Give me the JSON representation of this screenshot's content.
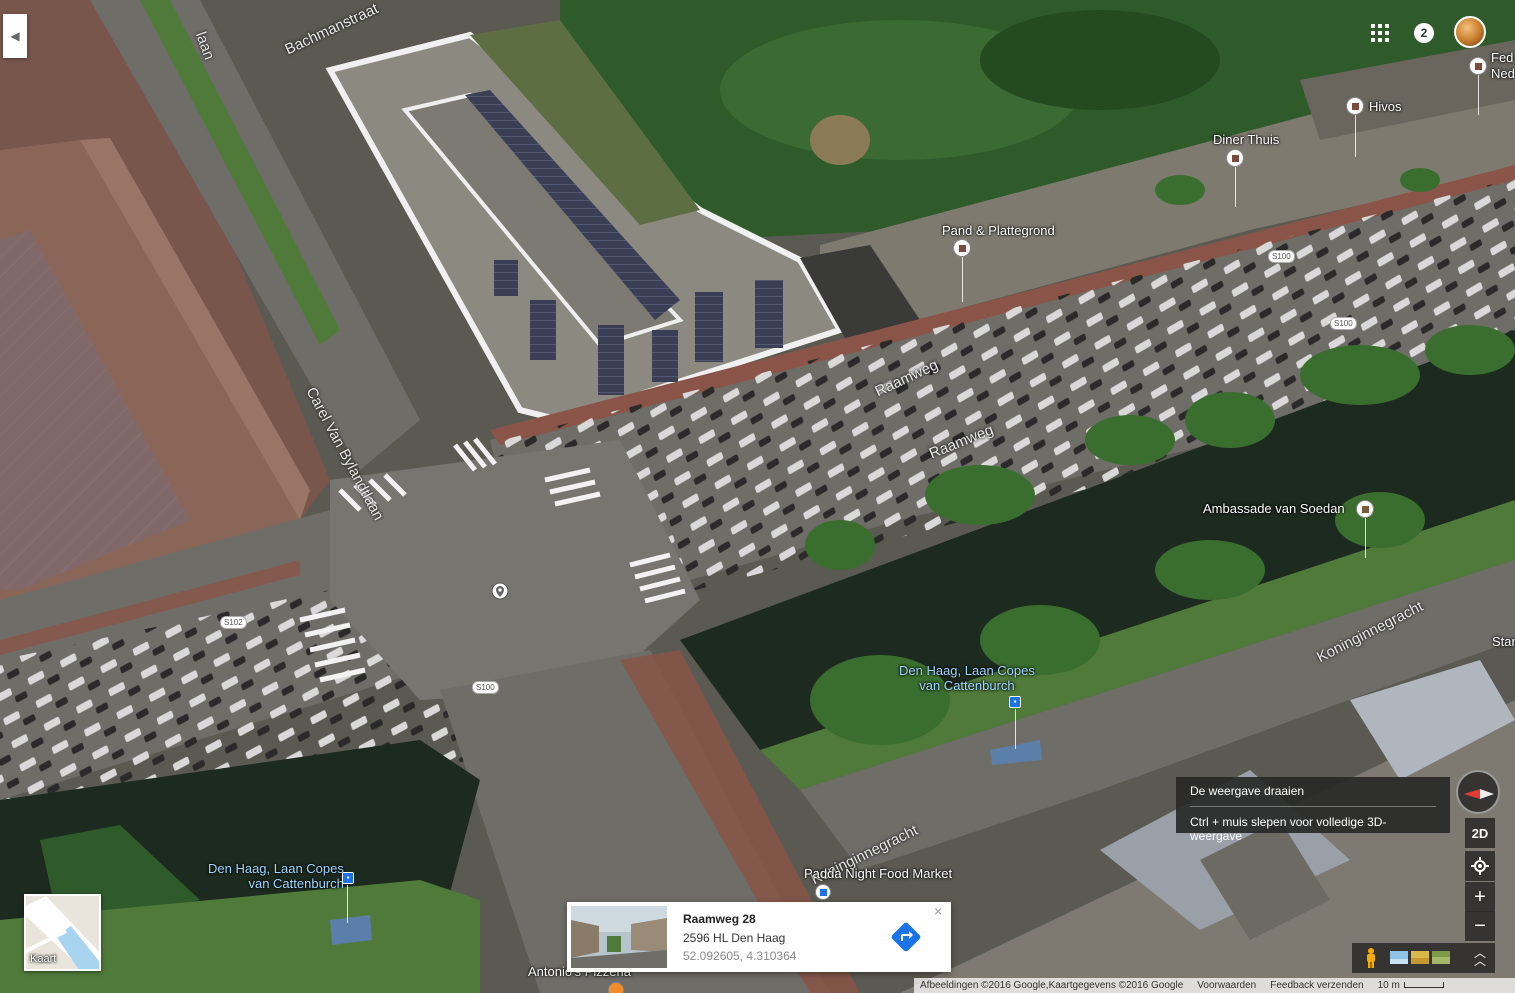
{
  "streets": {
    "bachmanstraat": "Bachmanstraat",
    "laan_top": "laan",
    "carel_van_bylandtlaan": "Carel Van Bylandtlaan",
    "raamweg_1": "Raamweg",
    "raamweg_2": "Raamweg",
    "koninginnegracht": "Koninginnegracht",
    "koninginnegracht_bottom": "Koninginnegracht"
  },
  "road_shields": {
    "s100_a": "S100",
    "s100_b": "S100",
    "s100_c": "S100",
    "s102": "S102"
  },
  "pois": {
    "pand_plattegrond": "Pand & Plattegrond",
    "diner_thuis": "Diner Thuis",
    "hivos": "Hivos",
    "fed_line1": "Fed",
    "fed_line2": "Ned",
    "ambassade_van_soedan": "Ambassade van Soedan",
    "den_haag_stop_1_line1": "Den Haag, Laan Copes",
    "den_haag_stop_1_line2": "van Cattenburch",
    "den_haag_stop_2_line1": "Den Haag, Laan Copes",
    "den_haag_stop_2_line2": "van Cattenburch",
    "padda_night_food_market": "Padda Night Food Market",
    "antonios_pizzeria": "Antonio's Pizzeria",
    "star_partial": "Star"
  },
  "header": {
    "notification_count": "2"
  },
  "tooltip": {
    "line1": "De weergave draaien",
    "line2": "Ctrl + muis slepen voor volledige 3D-weergave"
  },
  "controls": {
    "toggle_2d": "2D",
    "zoom_in": "+",
    "zoom_out": "−"
  },
  "minimap": {
    "label": "Kaart"
  },
  "place_card": {
    "title": "Raamweg 28",
    "address": "2596 HL Den Haag",
    "coordinates": "52.092605, 4.310364",
    "close": "×"
  },
  "attribution": {
    "imagery": "Afbeeldingen ©2016 Google,Kaartgegevens ©2016 Google",
    "terms": "Voorwaarden",
    "feedback": "Feedback verzenden",
    "scale": "10 m"
  },
  "colors": {
    "water": "#1d2a1f",
    "grass": "#4f7a3a",
    "trees": "#2f5a2a",
    "road": "#6e6d68",
    "bike_path": "#8a5548",
    "accent_blue": "#1a73e8",
    "compass_red": "#e53935"
  }
}
